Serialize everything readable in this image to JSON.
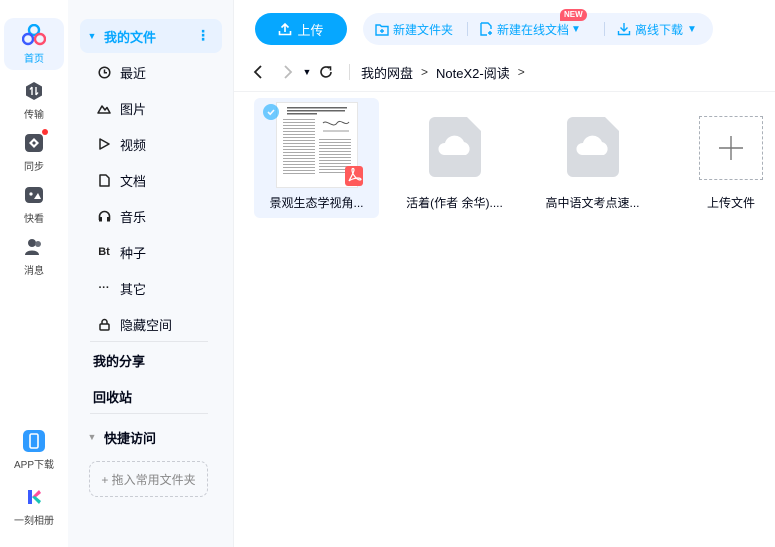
{
  "rail": {
    "items": [
      {
        "label": "首页",
        "icon": "home-cloud-icon",
        "active": true
      },
      {
        "label": "传输",
        "icon": "transfer-icon"
      },
      {
        "label": "同步",
        "icon": "sync-icon"
      },
      {
        "label": "快看",
        "icon": "quick-view-icon"
      },
      {
        "label": "消息",
        "icon": "message-icon"
      }
    ],
    "bottom": [
      {
        "label": "APP下载",
        "icon": "phone-icon"
      },
      {
        "label": "一刻相册",
        "icon": "album-icon"
      }
    ]
  },
  "sidebar": {
    "my_files": "我的文件",
    "items": [
      {
        "label": "最近",
        "icon": "clock-icon"
      },
      {
        "label": "图片",
        "icon": "image-icon"
      },
      {
        "label": "视频",
        "icon": "play-icon"
      },
      {
        "label": "文档",
        "icon": "document-icon"
      },
      {
        "label": "音乐",
        "icon": "headphone-icon"
      },
      {
        "label": "种子",
        "icon": "torrent-icon",
        "glyph": "Bt"
      },
      {
        "label": "其它",
        "icon": "more-icon",
        "glyph": "···"
      },
      {
        "label": "隐藏空间",
        "icon": "lock-icon"
      }
    ],
    "my_share": "我的分享",
    "recycle": "回收站",
    "quick_access": "快捷访问",
    "drop_zone": "+ 拖入常用文件夹"
  },
  "toolbar": {
    "upload": "上传",
    "new_folder": "新建文件夹",
    "new_online_doc": "新建在线文档",
    "new_badge": "NEW",
    "offline_download": "离线下载"
  },
  "breadcrumb": [
    "我的网盘",
    "NoteX2-阅读"
  ],
  "files": [
    {
      "name": "景观生态学视角...",
      "type": "pdf",
      "selected": true
    },
    {
      "name": "活着(作者 余华)....",
      "type": "cloud-doc"
    },
    {
      "name": "高中语文考点速...",
      "type": "cloud-doc"
    },
    {
      "name": "上传文件",
      "type": "upload"
    }
  ],
  "colors": {
    "accent": "#06a7ff",
    "selected_bg": "#eef4ff",
    "badge": "#ff5a6e"
  }
}
